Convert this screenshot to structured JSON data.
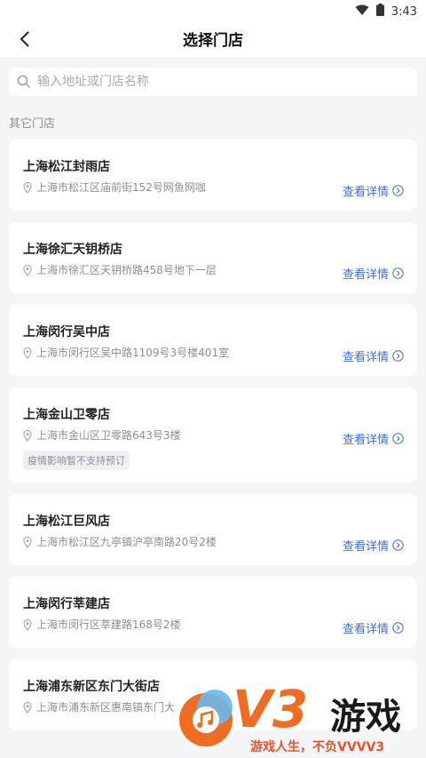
{
  "status_bar": {
    "time": "3:43"
  },
  "header": {
    "title": "选择门店"
  },
  "search": {
    "placeholder": "输入地址或门店名称"
  },
  "section_label": "其它门店",
  "detail_label": "查看详情",
  "stores": [
    {
      "name": "上海松江封雨店",
      "address": "上海市松江区庙前街152号网鱼网咖",
      "badge": ""
    },
    {
      "name": "上海徐汇天钥桥店",
      "address": "上海市徐汇区天钥桥路458号地下一层",
      "badge": ""
    },
    {
      "name": "上海闵行吴中店",
      "address": "上海市闵行区吴中路1109号3号楼401室",
      "badge": ""
    },
    {
      "name": "上海金山卫零店",
      "address": "上海市金山区卫零路643号3楼",
      "badge": "疫情影响暂不支持预订"
    },
    {
      "name": "上海松江巨风店",
      "address": "上海市松江区九亭镇沪亭南路20号2楼",
      "badge": ""
    },
    {
      "name": "上海闵行莘建店",
      "address": "上海市闵行区莘建路168号2楼",
      "badge": ""
    },
    {
      "name": "上海浦东新区东门大街店",
      "address": "上海市浦东新区惠南镇东门大",
      "badge": ""
    }
  ],
  "watermark": {
    "brand": "V3",
    "brand2": "游戏",
    "slogan": "游戏人生，不负VVVV3"
  },
  "colors": {
    "accent": "#3c6fe0",
    "background": "#f4f5f7",
    "watermark": "#ee6d22"
  }
}
